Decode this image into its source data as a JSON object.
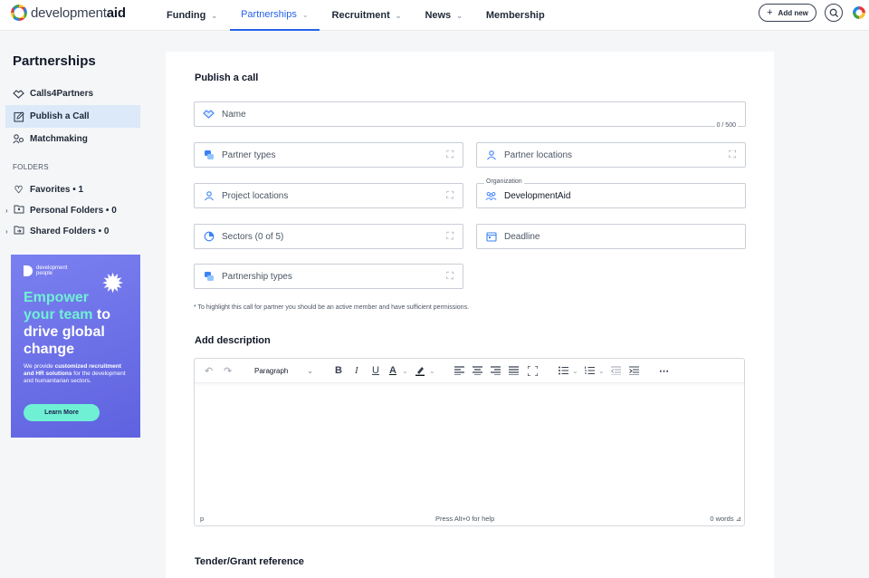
{
  "header": {
    "logo_prefix": "development",
    "logo_suffix": "aid",
    "nav": [
      {
        "label": "Funding",
        "has_menu": true
      },
      {
        "label": "Partnerships",
        "has_menu": true,
        "active": true
      },
      {
        "label": "Recruitment",
        "has_menu": true
      },
      {
        "label": "News",
        "has_menu": true
      },
      {
        "label": "Membership",
        "has_menu": false
      }
    ],
    "add_new_label": "Add new",
    "help_icon": "help-search-icon"
  },
  "sidebar": {
    "title": "Partnerships",
    "items": [
      {
        "label": "Calls4Partners",
        "icon": "handshake-icon"
      },
      {
        "label": "Publish a Call",
        "icon": "edit-icon",
        "active": true
      },
      {
        "label": "Matchmaking",
        "icon": "people-match-icon"
      }
    ],
    "folders_label": "FOLDERS",
    "folders": [
      {
        "label": "Favorites • 1",
        "icon": "heart-icon"
      },
      {
        "label": "Personal Folders • 0",
        "icon": "folder-user-icon"
      },
      {
        "label": "Shared Folders • 0",
        "icon": "folder-shared-icon"
      }
    ]
  },
  "ad": {
    "brand_line1": "development",
    "brand_line2": "people",
    "headline_1": "Empower",
    "headline_2": "your team",
    "headline_3": " to drive global change",
    "body_1": "We provide ",
    "body_bold": "customized recruitment and HR solutions",
    "body_2": " for the development and humanitarian sectors.",
    "button_label": "Learn More"
  },
  "form": {
    "title": "Publish a call",
    "name_placeholder": "Name",
    "name_count": "0 / 500",
    "partner_types": "Partner types",
    "partner_locations": "Partner locations",
    "project_locations": "Project locations",
    "organization_label": "Organization",
    "organization_value": "DevelopmentAid",
    "sectors": "Sectors (0 of 5)",
    "deadline": "Deadline",
    "partnership_types": "Partnership types",
    "note": "* To highlight this call for partner you should be an active member and have sufficient permissions."
  },
  "description": {
    "title": "Add description",
    "paragraph_select": "Paragraph",
    "status_left": "p",
    "status_center": "Press Alt+0 for help",
    "status_right": "0 words"
  },
  "reference": {
    "title": "Tender/Grant reference"
  },
  "colors": {
    "accent": "#2563eb",
    "active_bg": "#dbe9f8",
    "ad_bg": "#6a6fe8",
    "ad_highlight": "#6ff0d4"
  }
}
